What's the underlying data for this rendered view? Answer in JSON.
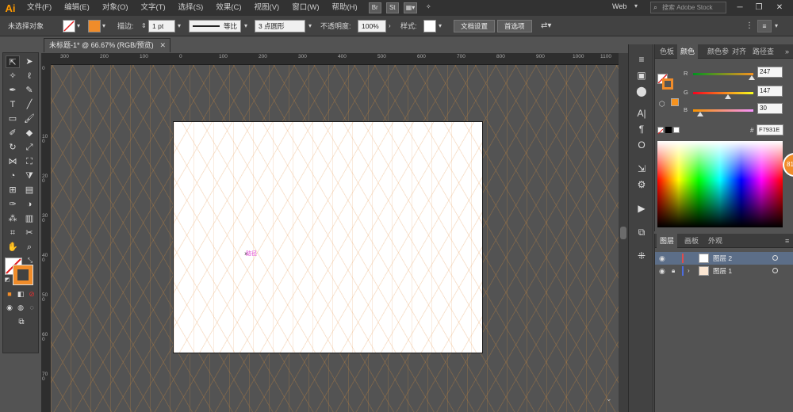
{
  "app": {
    "logo": "Ai"
  },
  "menu": [
    "文件(F)",
    "编辑(E)",
    "对象(O)",
    "文字(T)",
    "选择(S)",
    "效果(C)",
    "视图(V)",
    "窗口(W)",
    "帮助(H)"
  ],
  "menu_buttons": [
    "Br",
    "St"
  ],
  "workspace": {
    "label": "Web",
    "search_placeholder": "搜索 Adobe Stock"
  },
  "control_bar": {
    "selection_status": "未选择对象",
    "stroke_label": "描边:",
    "stroke_weight": "1 pt",
    "profile": "等比",
    "brush": "3 点圆形",
    "opacity_label": "不透明度:",
    "opacity_value": "100%",
    "style_label": "样式:",
    "doc_setup": "文档设置",
    "preferences": "首选项"
  },
  "document": {
    "tab_title": "未标题-1* @ 66.67% (RGB/预览)",
    "path_hint": "路径"
  },
  "rulers": {
    "horizontal": [
      "300",
      "200",
      "100",
      "0",
      "100",
      "200",
      "300",
      "400",
      "500",
      "600",
      "700",
      "800",
      "900",
      "1000",
      "1100"
    ],
    "vertical": [
      "0",
      "100",
      "200",
      "300",
      "400",
      "500",
      "600",
      "700"
    ]
  },
  "color_panel": {
    "tabs": [
      "色板",
      "颜色",
      "颜色参",
      "对齐",
      "路径查"
    ],
    "active_tab": 1,
    "channels": [
      {
        "label": "R",
        "value": "247",
        "fraction": 0.969
      },
      {
        "label": "G",
        "value": "147",
        "fraction": 0.576
      },
      {
        "label": "B",
        "value": "30",
        "fraction": 0.118
      }
    ],
    "hex_label": "#",
    "hex": "F7931E",
    "fill_color": "#F7931E",
    "badge": "81"
  },
  "layers_panel": {
    "tabs": [
      "图层",
      "画板",
      "外观"
    ],
    "layers": [
      {
        "name": "图层 2",
        "color": "#e04c4c",
        "selected": true
      },
      {
        "name": "图层 1",
        "color": "#4c6ce0",
        "selected": false
      }
    ]
  }
}
